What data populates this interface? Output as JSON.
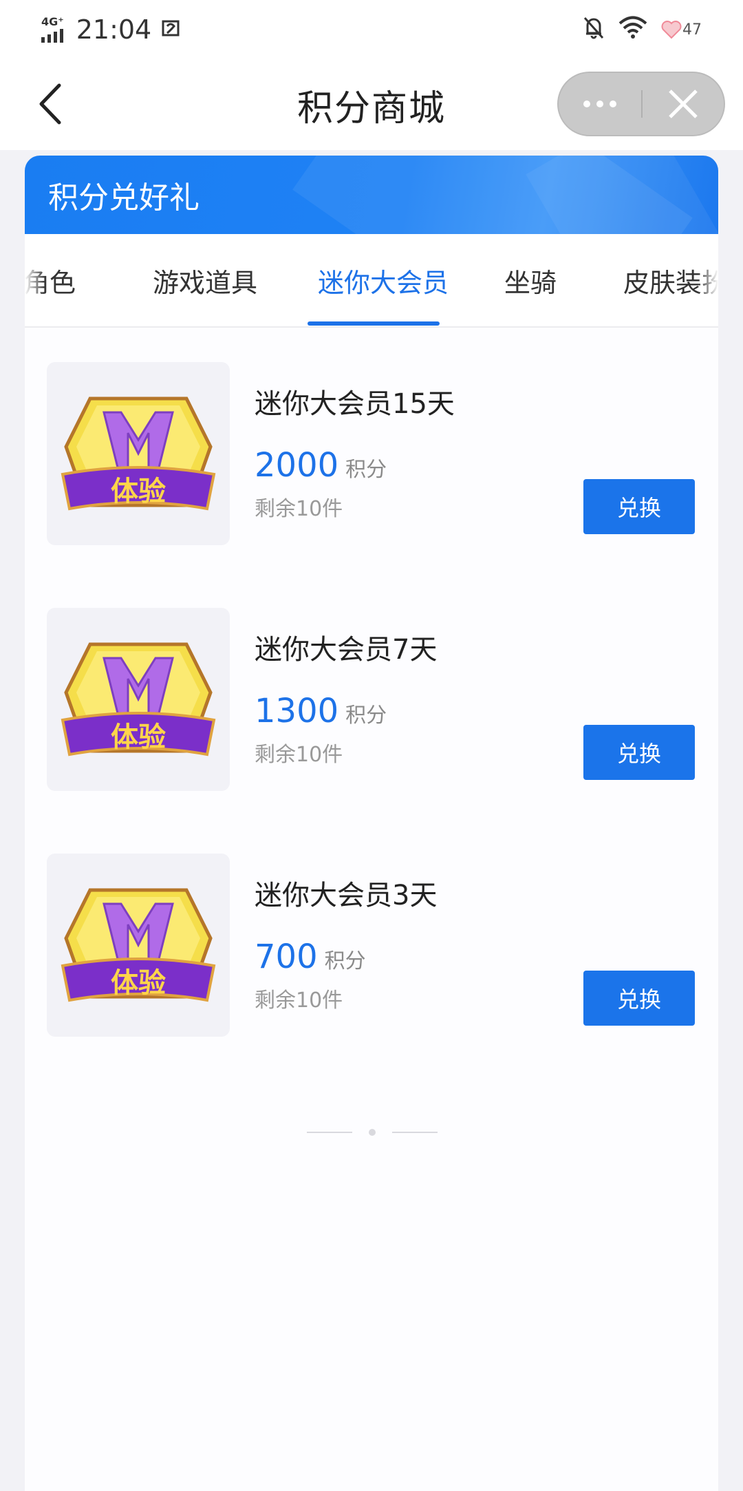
{
  "status_bar": {
    "network": "4G⁺",
    "time": "21:04",
    "battery": "47"
  },
  "nav": {
    "title": "积分商城"
  },
  "banner": {
    "title": "积分兑好礼"
  },
  "tabs": [
    {
      "label": "角色",
      "active": false
    },
    {
      "label": "游戏道具",
      "active": false
    },
    {
      "label": "迷你大会员",
      "active": true
    },
    {
      "label": "坐骑",
      "active": false
    },
    {
      "label": "皮肤装扮",
      "active": false
    }
  ],
  "products": [
    {
      "name": "迷你大会员15天",
      "price": "2000",
      "unit": "积分",
      "stock": "剩余10件",
      "button": "兑换",
      "badge_text": "体验"
    },
    {
      "name": "迷你大会员7天",
      "price": "1300",
      "unit": "积分",
      "stock": "剩余10件",
      "button": "兑换",
      "badge_text": "体验"
    },
    {
      "name": "迷你大会员3天",
      "price": "700",
      "unit": "积分",
      "stock": "剩余10件",
      "button": "兑换",
      "badge_text": "体验"
    }
  ],
  "colors": {
    "accent": "#1d72e8",
    "banner": "#1a7df2",
    "background": "#f2f2f6"
  },
  "icons": {
    "back": "chevron-left-icon",
    "more": "more-dots-icon",
    "close": "close-icon",
    "mute": "bell-off-icon",
    "wifi": "wifi-icon",
    "battery": "heart-battery-icon"
  }
}
